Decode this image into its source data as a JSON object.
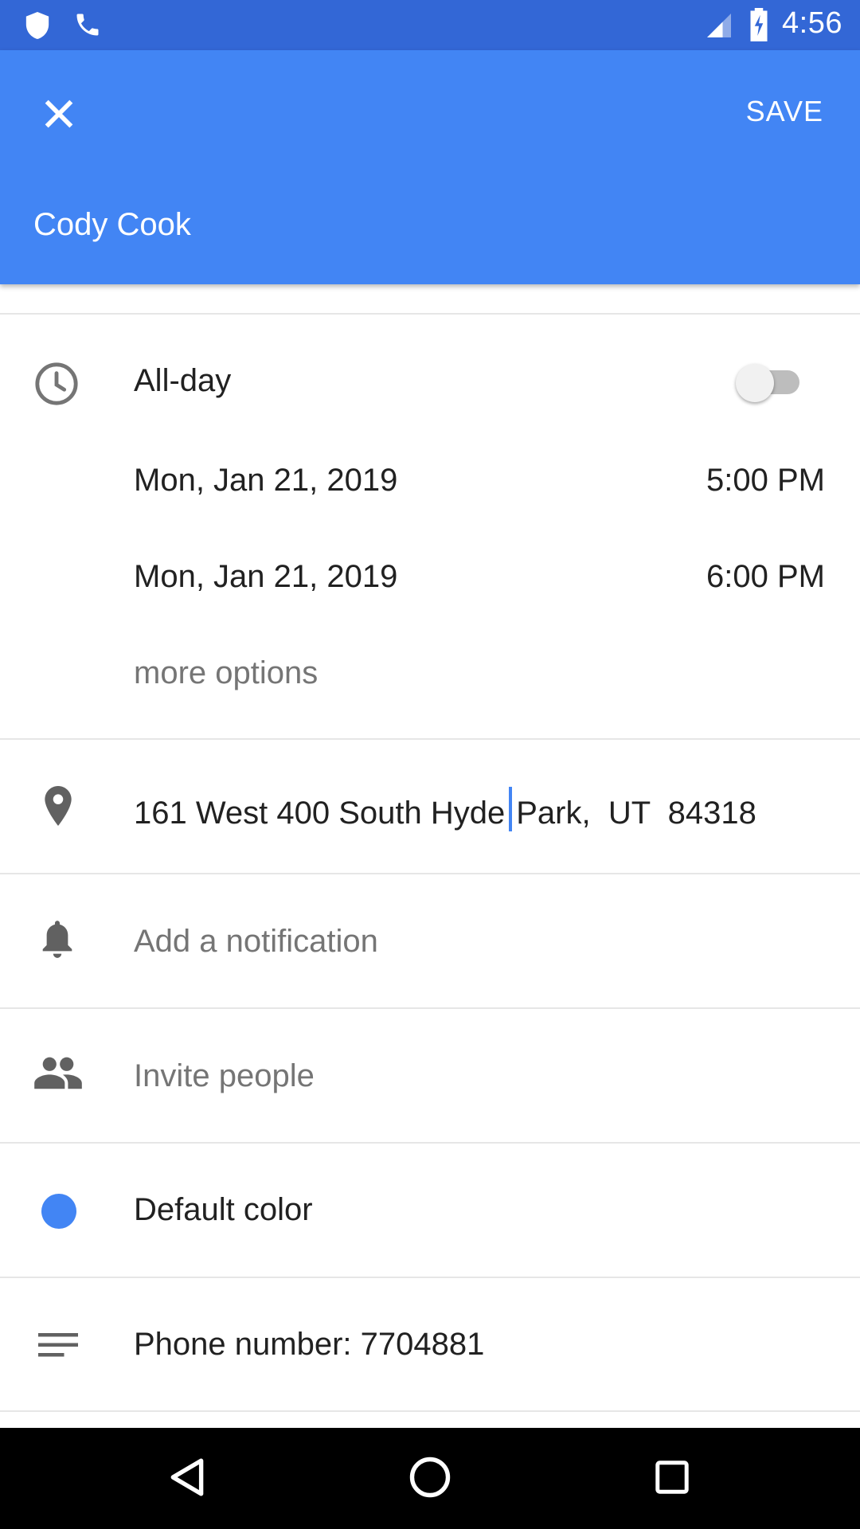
{
  "status_bar": {
    "time": "4:56",
    "icons": [
      "shield-icon",
      "phone-icon",
      "signal-icon",
      "battery-charging-icon"
    ]
  },
  "app_bar": {
    "close_icon": "close-icon",
    "save_label": "SAVE",
    "title": "Cody Cook",
    "color": "#4285f4"
  },
  "time_section": {
    "all_day_label": "All-day",
    "all_day_on": false,
    "start_date": "Mon, Jan 21, 2019",
    "start_time": "5:00 PM",
    "end_date": "Mon, Jan 21, 2019",
    "end_time": "6:00 PM",
    "more_options": "more options"
  },
  "location": {
    "value_before_cursor": "161 West 400 South Hyde",
    "value_after_cursor": "Park,  UT  84318"
  },
  "notification": {
    "placeholder": "Add a notification"
  },
  "invite": {
    "placeholder": "Invite people"
  },
  "color_row": {
    "label": "Default color",
    "color": "#4285f4"
  },
  "description": {
    "value": "Phone number: 7704881"
  },
  "nav_bar": {
    "icons": [
      "back-icon",
      "home-icon",
      "recents-icon"
    ]
  }
}
